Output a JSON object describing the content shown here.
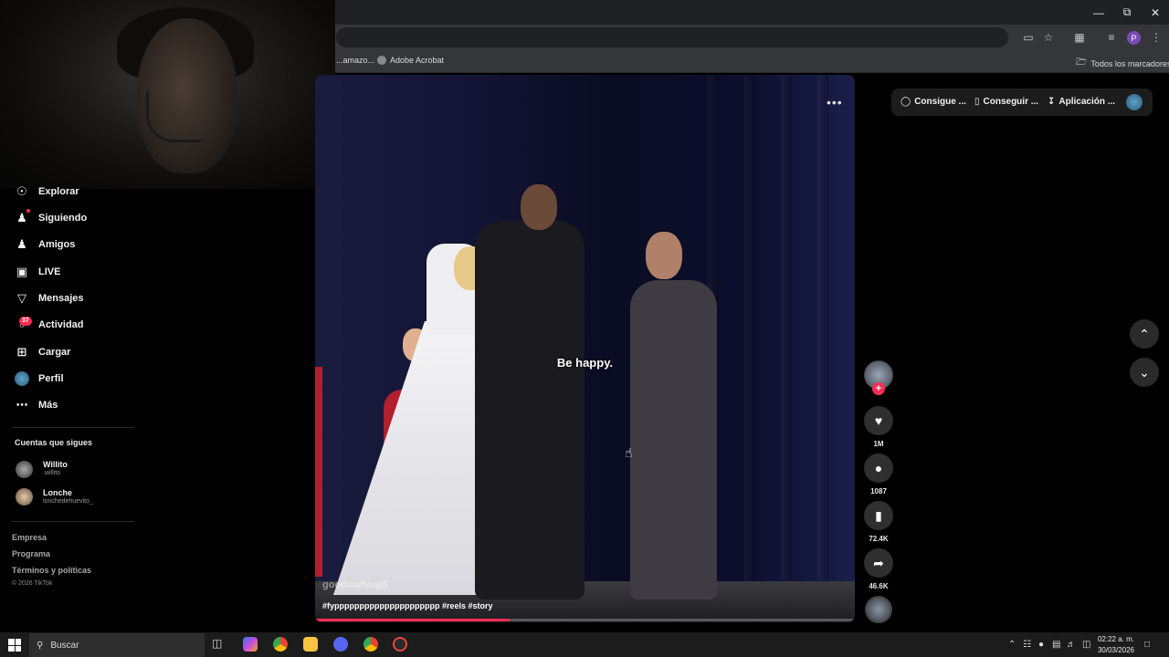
{
  "browser": {
    "bookmarks": [
      {
        "label": "...amazo..."
      },
      {
        "label": "Adobe Acrobat"
      }
    ],
    "all_bookmarks_label": "Todos los marcadores",
    "profile_initial": "P"
  },
  "sidebar": {
    "nav": [
      {
        "label": "Explorar",
        "icon": "compass-icon"
      },
      {
        "label": "Siguiendo",
        "icon": "following-icon"
      },
      {
        "label": "Amigos",
        "icon": "friends-icon"
      },
      {
        "label": "LIVE",
        "icon": "live-icon"
      },
      {
        "label": "Mensajes",
        "icon": "messages-icon"
      },
      {
        "label": "Actividad",
        "icon": "activity-icon"
      },
      {
        "label": "Cargar",
        "icon": "upload-icon"
      },
      {
        "label": "Perfil",
        "icon": "profile-icon"
      },
      {
        "label": "Más",
        "icon": "more-icon"
      }
    ],
    "activity_badge": "37",
    "following_title": "Cuentas que sigues",
    "following": [
      {
        "name": "Willito",
        "username": ".willito"
      },
      {
        "name": "Lonche",
        "username": "lonchedehuevito_"
      }
    ],
    "footer": [
      "Empresa",
      "Programa",
      "Términos y políticas"
    ],
    "copyright": "© 2026 TikTok"
  },
  "top_actions": {
    "coins": "Consigue ...",
    "get": "Conseguir ...",
    "app": "Aplicación ..."
  },
  "video": {
    "subtitle": "Be happy.",
    "author": "goodowfvug8",
    "caption": "#fyppppppppppppppppppppp #reels #story",
    "progress": 0.36
  },
  "actions": {
    "likes": "1M",
    "comments": "1087",
    "saves": "72.4K",
    "shares": "46.6K"
  },
  "taskbar": {
    "search_placeholder": "Buscar",
    "time": "02:22 a. m.",
    "date": "30/03/2026"
  },
  "colors": {
    "accent": "#fe2c55",
    "background": "#000000"
  }
}
